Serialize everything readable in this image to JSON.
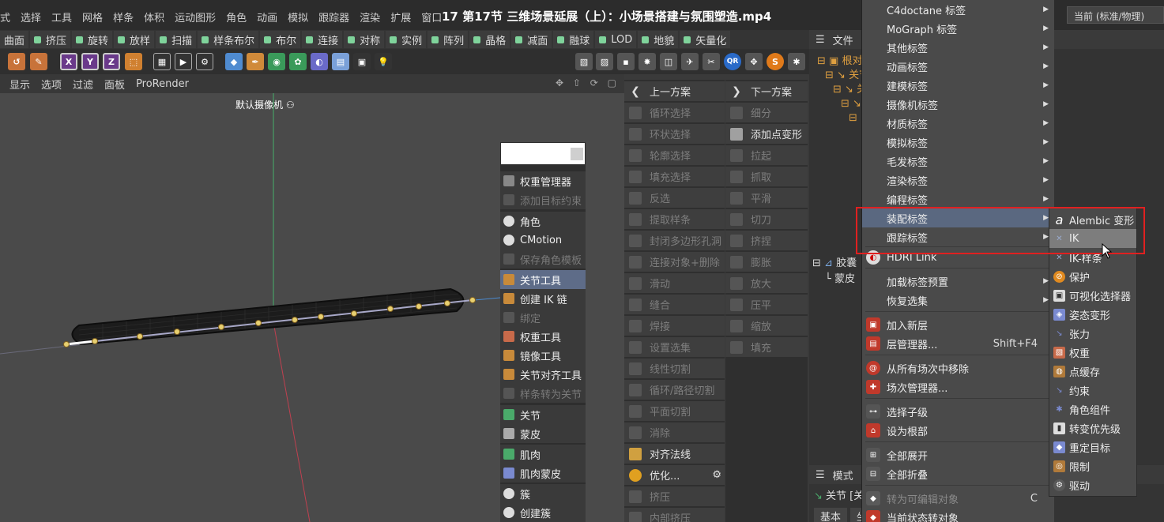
{
  "menubar": {
    "items": [
      "式",
      "选择",
      "工具",
      "网格",
      "样条",
      "体积",
      "运动图形",
      "角色",
      "动画",
      "模拟",
      "跟踪器",
      "渲染",
      "扩展",
      "窗口"
    ],
    "video_title": "17 第17节 三维场景延展（上）：小场景搭建与氛围塑造.mp4",
    "layout_value": "当前 (标准/物理)"
  },
  "toolbar1": {
    "items": [
      "曲面",
      "挤压",
      "旋转",
      "放样",
      "扫描",
      "样条布尔",
      "布尔",
      "连接",
      "对称",
      "实例",
      "阵列",
      "晶格",
      "减面",
      "融球",
      "LOD",
      "地貌",
      "矢量化"
    ]
  },
  "toolbar2": {
    "axis_x": "X",
    "axis_y": "Y",
    "axis_z": "Z",
    "qr": "QR",
    "s": "S"
  },
  "viewport_menu": {
    "items": [
      "显示",
      "选项",
      "过滤",
      "面板",
      "ProRender"
    ]
  },
  "viewport": {
    "camera_label": "默认摄像机"
  },
  "character_panel": {
    "items": [
      {
        "label": "权重管理器",
        "state": "normal"
      },
      {
        "label": "添加目标约束",
        "state": "disabled"
      },
      {
        "label": "角色",
        "state": "normal"
      },
      {
        "label": "CMotion",
        "state": "normal"
      },
      {
        "label": "保存角色模板",
        "state": "disabled"
      },
      {
        "label": "关节工具",
        "state": "active"
      },
      {
        "label": "创建 IK 链",
        "state": "normal"
      },
      {
        "label": "绑定",
        "state": "disabled"
      },
      {
        "label": "权重工具",
        "state": "normal"
      },
      {
        "label": "镜像工具",
        "state": "normal"
      },
      {
        "label": "关节对齐工具",
        "state": "normal"
      },
      {
        "label": "样条转为关节",
        "state": "disabled"
      },
      {
        "label": "关节",
        "state": "normal"
      },
      {
        "label": "蒙皮",
        "state": "normal"
      },
      {
        "label": "肌肉",
        "state": "normal"
      },
      {
        "label": "肌肉蒙皮",
        "state": "normal"
      },
      {
        "label": "簇",
        "state": "normal"
      },
      {
        "label": "创建簇",
        "state": "normal"
      }
    ]
  },
  "mesh_ops_left": {
    "items": [
      "上一方案",
      "循环选择",
      "环状选择",
      "轮廓选择",
      "填充选择",
      "反选",
      "提取样条",
      "封闭多边形孔洞",
      "连接对象+删除",
      "滑动",
      "缝合",
      "焊接",
      "设置选集",
      "线性切割",
      "循环/路径切割",
      "平面切割",
      "消除",
      "对齐法线",
      "优化...",
      "挤压",
      "内部挤压"
    ]
  },
  "mesh_ops_right": {
    "items": [
      "下一方案",
      "细分",
      "添加点变形",
      "拉起",
      "抓取",
      "平滑",
      "切刀",
      "挤捏",
      "膨胀",
      "放大",
      "压平",
      "缩放",
      "填充"
    ]
  },
  "object_manager": {
    "header_label": "文件",
    "tree_items": [
      "根对象",
      "关节",
      "关节",
      "关节",
      "关节"
    ],
    "row_joint": "胶囊",
    "row_skin": "蒙皮"
  },
  "attribute_manager": {
    "header_label": "模式",
    "row": "关节 [关节]",
    "tabs": [
      "基本",
      "坐标"
    ]
  },
  "context_menu": {
    "items": [
      {
        "label": "C4doctane 标签",
        "arrow": true
      },
      {
        "label": "MoGraph 标签",
        "arrow": true
      },
      {
        "label": "其他标签",
        "arrow": true
      },
      {
        "label": "动画标签",
        "arrow": true
      },
      {
        "label": "建模标签",
        "arrow": true
      },
      {
        "label": "摄像机标签",
        "arrow": true
      },
      {
        "label": "材质标签",
        "arrow": true
      },
      {
        "label": "模拟标签",
        "arrow": true
      },
      {
        "label": "毛发标签",
        "arrow": true
      },
      {
        "label": "渲染标签",
        "arrow": true
      },
      {
        "label": "编程标签",
        "arrow": true
      },
      {
        "label": "装配标签",
        "arrow": true
      },
      {
        "label": "跟踪标签",
        "arrow": true
      },
      {
        "label": "HDRI Link",
        "arrow": false
      },
      {
        "label": "加载标签预置",
        "arrow": true
      },
      {
        "label": "恢复选集",
        "arrow": true
      },
      {
        "label": "加入新层",
        "arrow": false
      },
      {
        "label": "层管理器...",
        "arrow": false,
        "shortcut": "Shift+F4"
      },
      {
        "label": "从所有场次中移除",
        "arrow": false
      },
      {
        "label": "场次管理器...",
        "arrow": false
      },
      {
        "label": "选择子级",
        "arrow": false
      },
      {
        "label": "设为根部",
        "arrow": false
      },
      {
        "label": "全部展开",
        "arrow": false
      },
      {
        "label": "全部折叠",
        "arrow": false
      },
      {
        "label": "转为可编辑对象",
        "arrow": false,
        "shortcut": "C"
      },
      {
        "label": "当前状态转对象",
        "arrow": false
      }
    ]
  },
  "submenu": {
    "items": [
      "Alembic 变形",
      "IK",
      "IK-样条",
      "保护",
      "可视化选择器",
      "姿态变形",
      "张力",
      "权重",
      "点缓存",
      "约束",
      "角色组件",
      "转变优先级",
      "重定目标",
      "限制",
      "驱动"
    ]
  },
  "colors": {
    "accent_highlight": "#5a6880",
    "annotation_red": "#e02020",
    "viewport_bg": "#4a4a4a"
  }
}
